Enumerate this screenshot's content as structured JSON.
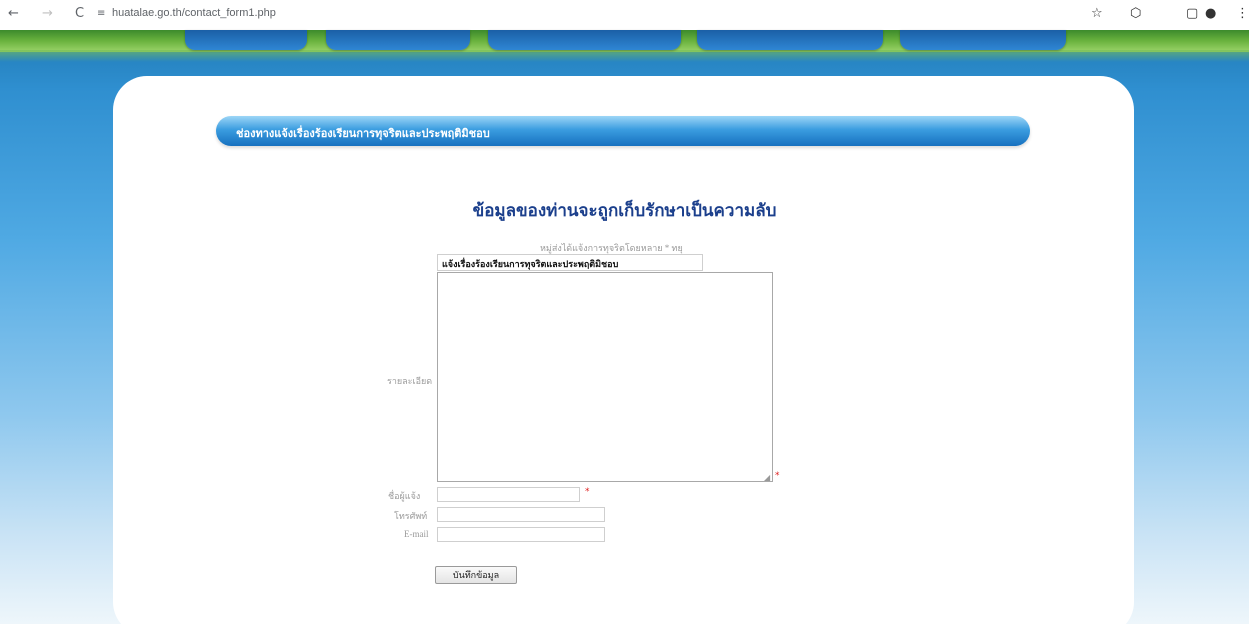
{
  "browser": {
    "url": "huatalae.go.th/contact_form1.php",
    "back": "←",
    "forward": "→",
    "reload": "C",
    "site_info": "≡",
    "icons": [
      "☆",
      "⬡",
      "▢",
      "●",
      "⋮"
    ]
  },
  "banner": {
    "title": "ช่องทางแจ้งเรื่องร้องเรียนการทุจริตและประพฤติมิชอบ"
  },
  "heading": "ข้อมูลของท่านจะถูกเก็บรักษาเป็นความลับ",
  "form": {
    "subject_label": "หมู่ส่งได้แจ้งการทุจริตโดยหลาย * ทยุ",
    "subject_value": "แจ้งเรื่องร้องเรียนการทุจริตและประพฤติมิชอบ",
    "detail_label": "รายละเอียด",
    "name_label": "ชื่อผู้แจ้ง",
    "phone_label": "โทรศัพท์",
    "email_label": "E-mail",
    "required_mark": "*",
    "submit_label": "บันทึกข้อมูล"
  }
}
